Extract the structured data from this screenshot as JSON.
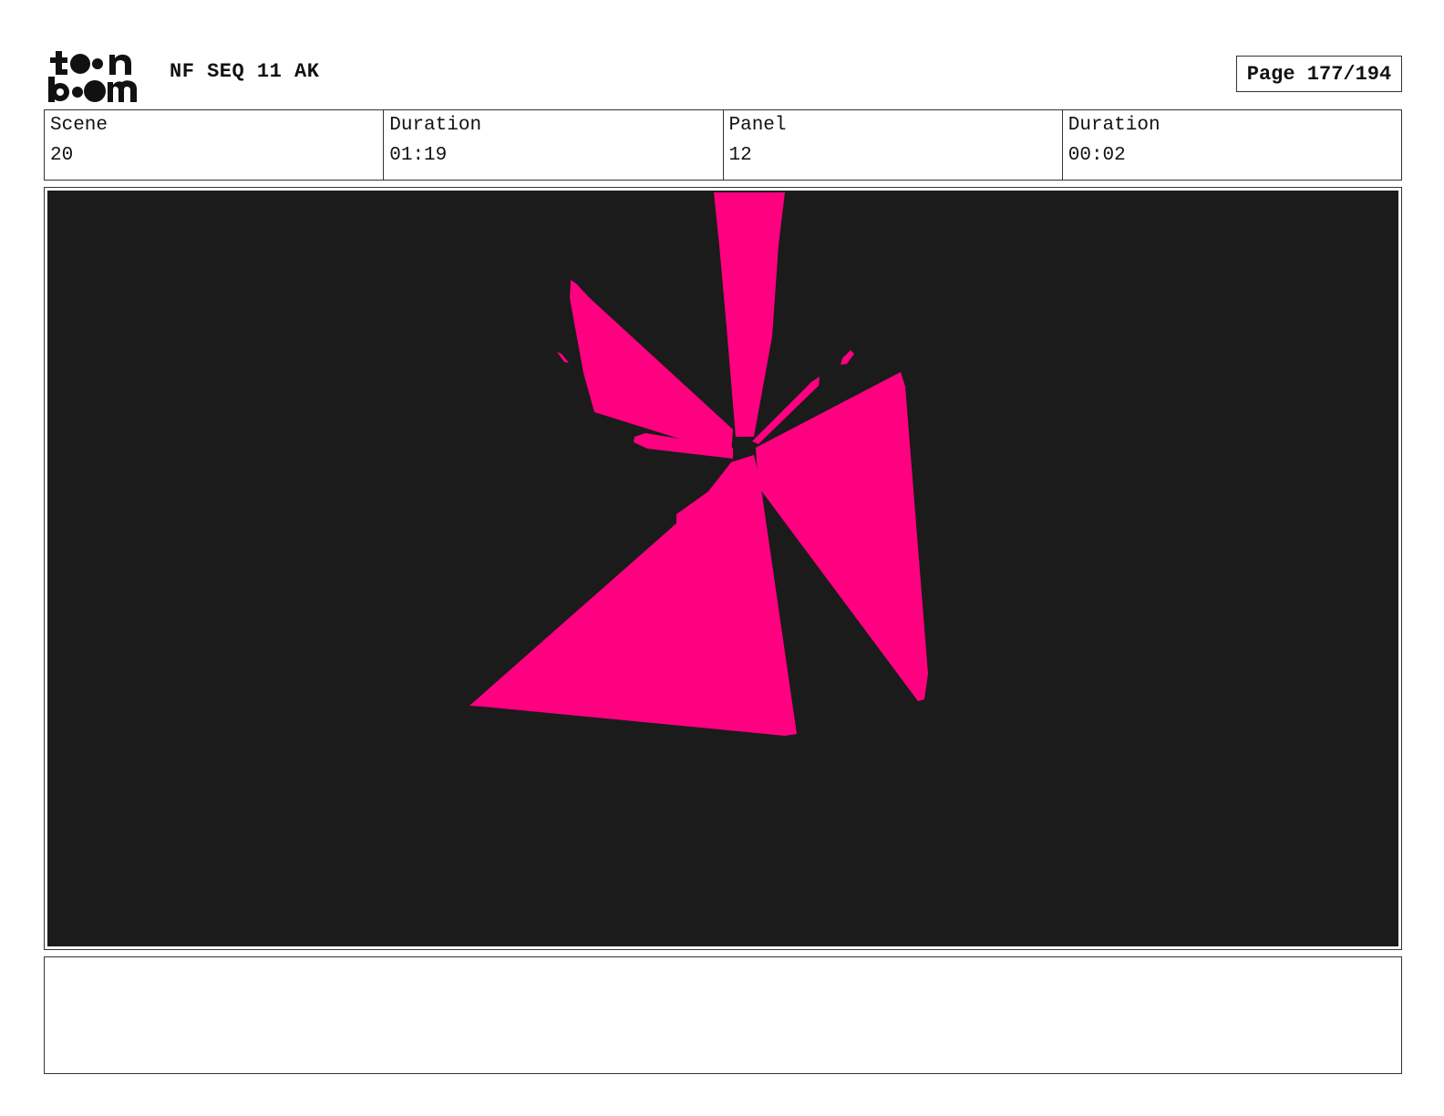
{
  "header": {
    "logo_text": "toon boom",
    "project_title": "NF SEQ 11 AK",
    "page_label": "Page 177/194"
  },
  "info": {
    "scene_label": "Scene",
    "scene_value": "20",
    "scene_duration_label": "Duration",
    "scene_duration_value": "01:19",
    "panel_label": "Panel",
    "panel_value": "12",
    "panel_duration_label": "Duration",
    "panel_duration_value": "00:02"
  },
  "panel": {
    "background_color": "#1b1b1b",
    "shape_color": "#ff0080"
  },
  "notes": {
    "text": ""
  }
}
